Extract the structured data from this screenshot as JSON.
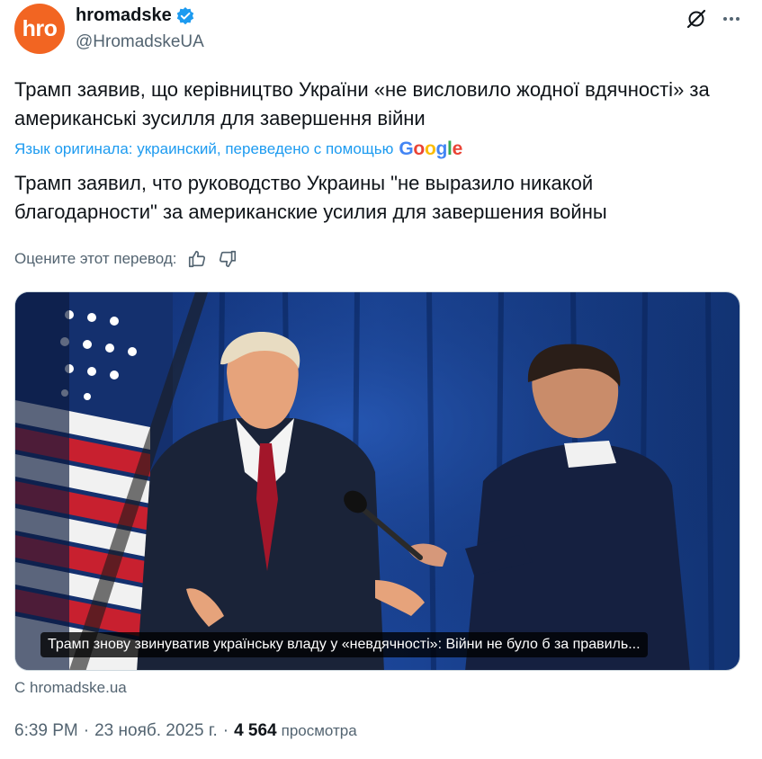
{
  "author": {
    "avatar_text": "hro",
    "display_name": "hromadske",
    "handle": "@HromadskeUA",
    "verified": true
  },
  "tweet": {
    "original_text": "Трамп заявив, що керівництво України «не висловило жодної вдячності» за американські зусилля для завершення війни",
    "translation_note": "Язык оригинала: украинский, переведено с помощью",
    "translation_provider": "Google",
    "translated_text": "Трамп заявил, что руководство Украины \"не выразило никакой благодарности\" за американские усилия для завершения войны",
    "rate_prompt": "Оцените этот перевод:"
  },
  "card": {
    "caption": "Трамп знову звинуватив українську владу у «невдячності»: Війни не було б за правиль...",
    "source": "С hromadske.ua"
  },
  "meta": {
    "time": "6:39 PM",
    "date": "23 нояб. 2025 г.",
    "separator": "·",
    "views_count": "4 564",
    "views_label": "просмотра"
  },
  "icons": {
    "verified": "verified-badge-icon",
    "grok": "grok-icon",
    "more": "more-icon",
    "like_translation": "thumbs-up-icon",
    "dislike_translation": "thumbs-down-icon"
  },
  "colors": {
    "accent": "#1d9bf0",
    "avatar_bg": "#f26522",
    "secondary_text": "#536471",
    "primary_text": "#0f1419"
  }
}
